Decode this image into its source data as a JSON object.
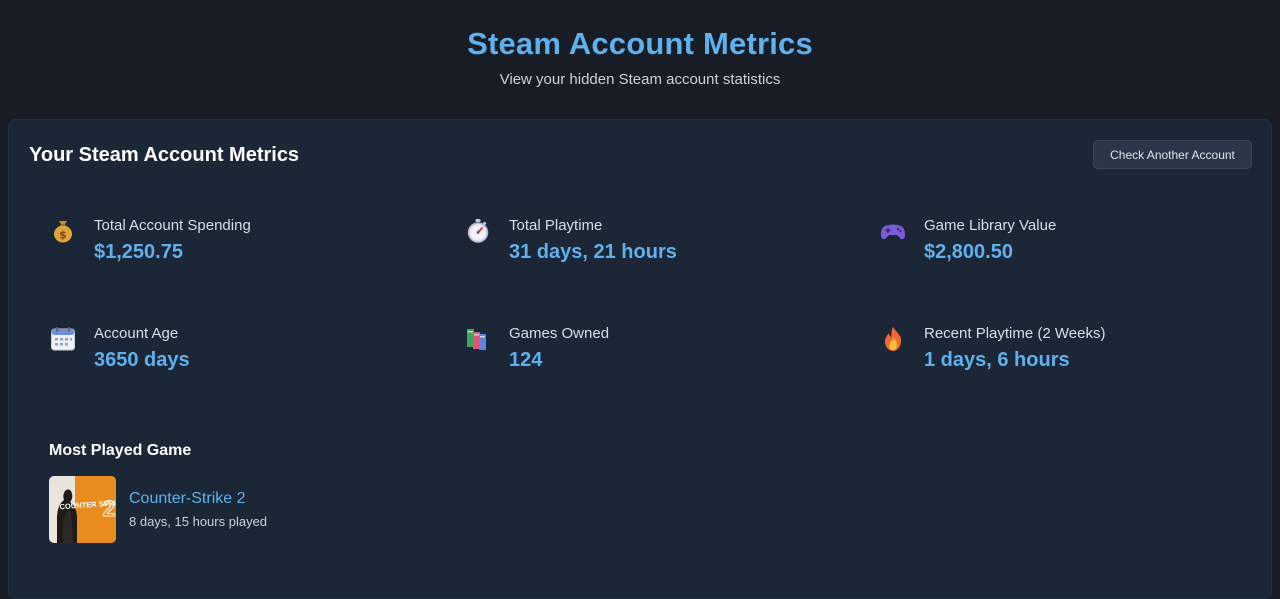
{
  "header": {
    "title": "Steam Account Metrics",
    "subtitle": "View your hidden Steam account statistics"
  },
  "card": {
    "title": "Your Steam Account Metrics",
    "check_button_label": "Check Another Account"
  },
  "metrics": [
    {
      "icon": "money-bag-icon",
      "label": "Total Account Spending",
      "value": "$1,250.75"
    },
    {
      "icon": "stopwatch-icon",
      "label": "Total Playtime",
      "value": "31 days, 21 hours"
    },
    {
      "icon": "game-controller-icon",
      "label": "Game Library Value",
      "value": "$2,800.50"
    },
    {
      "icon": "calendar-icon",
      "label": "Account Age",
      "value": "3650 days"
    },
    {
      "icon": "books-icon",
      "label": "Games Owned",
      "value": "124"
    },
    {
      "icon": "fire-icon",
      "label": "Recent Playtime (2 Weeks)",
      "value": "1 days, 6 hours"
    }
  ],
  "most_played": {
    "section_title": "Most Played Game",
    "name": "Counter-Strike 2",
    "playtime": "8 days, 15 hours played",
    "thumb_text": "COUNTER STRIKE",
    "thumb_number": "2"
  },
  "colors": {
    "accent": "#5fb1ee",
    "background": "#171c25",
    "card": "#1b2636"
  }
}
